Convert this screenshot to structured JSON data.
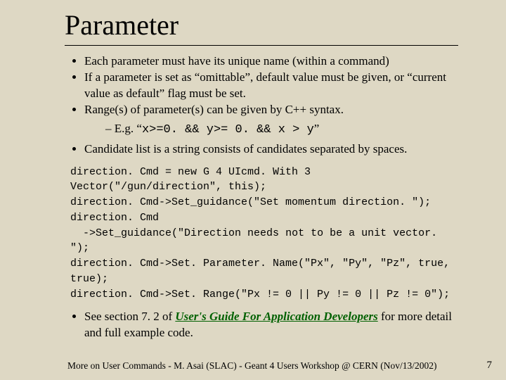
{
  "title": "Parameter",
  "bullets": {
    "b1": "Each parameter must have its unique name (within a command)",
    "b2": "If a parameter is set as “omittable”, default value must be given, or “current value as default” flag must be set.",
    "b3": "Range(s) of parameter(s) can be given by C++ syntax.",
    "b3_sub_a": "E.g. “",
    "b3_sub_code": "x>=0. && y>= 0. && x > y",
    "b3_sub_b": "”",
    "b4": "Candidate list is a string consists of candidates separated by spaces.",
    "b5_a": "See section 7. 2 of ",
    "b5_link": "User's Guide For Application Developers",
    "b5_b": " for more detail and full example code."
  },
  "code": [
    "direction. Cmd = new G 4 UIcmd. With 3 Vector(\"/gun/direction\", this);",
    "direction. Cmd->Set_guidance(\"Set momentum direction. \");",
    "direction. Cmd",
    "  ->Set_guidance(\"Direction needs not to be a unit vector. \");",
    "direction. Cmd->Set. Parameter. Name(\"Px\", \"Py\", \"Pz\", true, true);",
    "direction. Cmd->Set. Range(\"Px != 0 || Py != 0 || Pz != 0\");"
  ],
  "footer": "More on User Commands - M. Asai (SLAC) - Geant 4 Users Workshop @ CERN (Nov/13/2002)",
  "page": "7"
}
